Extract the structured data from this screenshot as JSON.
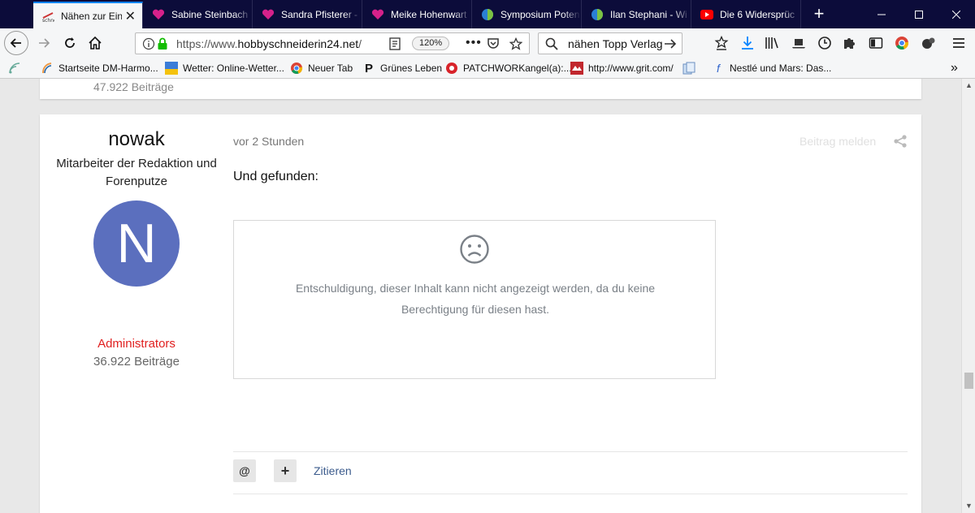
{
  "tabs": [
    {
      "label": "Nähen zur Eins",
      "active": true,
      "icon": "sewing-favicon"
    },
    {
      "label": "Sabine Steinbach",
      "icon": "heart-favicon"
    },
    {
      "label": "Sandra Pfisterer -",
      "icon": "heart-favicon"
    },
    {
      "label": "Meike Hohenwart",
      "icon": "heart-favicon"
    },
    {
      "label": "Symposium Poten",
      "icon": "leaf-favicon"
    },
    {
      "label": "Ilan Stephani - Wi",
      "icon": "leaf-favicon"
    },
    {
      "label": "Die 6 Widersprüc",
      "icon": "youtube-favicon"
    }
  ],
  "nav": {
    "url_prefix": "https://www.",
    "url_domain": "hobbyschneiderin24.net",
    "url_suffix": "/",
    "zoom": "120%",
    "search_value": "nähen  Topp Verlag"
  },
  "bookmarks": [
    {
      "label": "Startseite DM-Harmo..."
    },
    {
      "label": "Wetter: Online-Wetter..."
    },
    {
      "label": "Neuer Tab"
    },
    {
      "label": "Grünes Leben"
    },
    {
      "label": "PATCHWORKangel(a):..."
    },
    {
      "label": "http://www.grit.com/"
    },
    {
      "label": ""
    },
    {
      "label": "Nestlé und Mars: Das..."
    }
  ],
  "prev_post": {
    "posts_partial": "47.922 Beiträge"
  },
  "post": {
    "username": "nowak",
    "user_title": "Mitarbeiter der Redaktion und Forenputze",
    "avatar_letter": "N",
    "role": "Administrators",
    "post_count": "36.922 Beiträge",
    "time": "vor 2 Stunden",
    "report": "Beitrag melden",
    "body": "Und gefunden:",
    "error_message": "Entschuldigung, dieser Inhalt kann nicht angezeigt werden, da du keine Berechtigung für diesen hast.",
    "mention_label": "@",
    "plus_label": "+",
    "quote_label": "Zitieren"
  },
  "colors": {
    "tabstrip": "#0c0c3a",
    "avatar": "#5b6fbe",
    "role": "#e01e1e",
    "link": "#3b5b8c"
  }
}
